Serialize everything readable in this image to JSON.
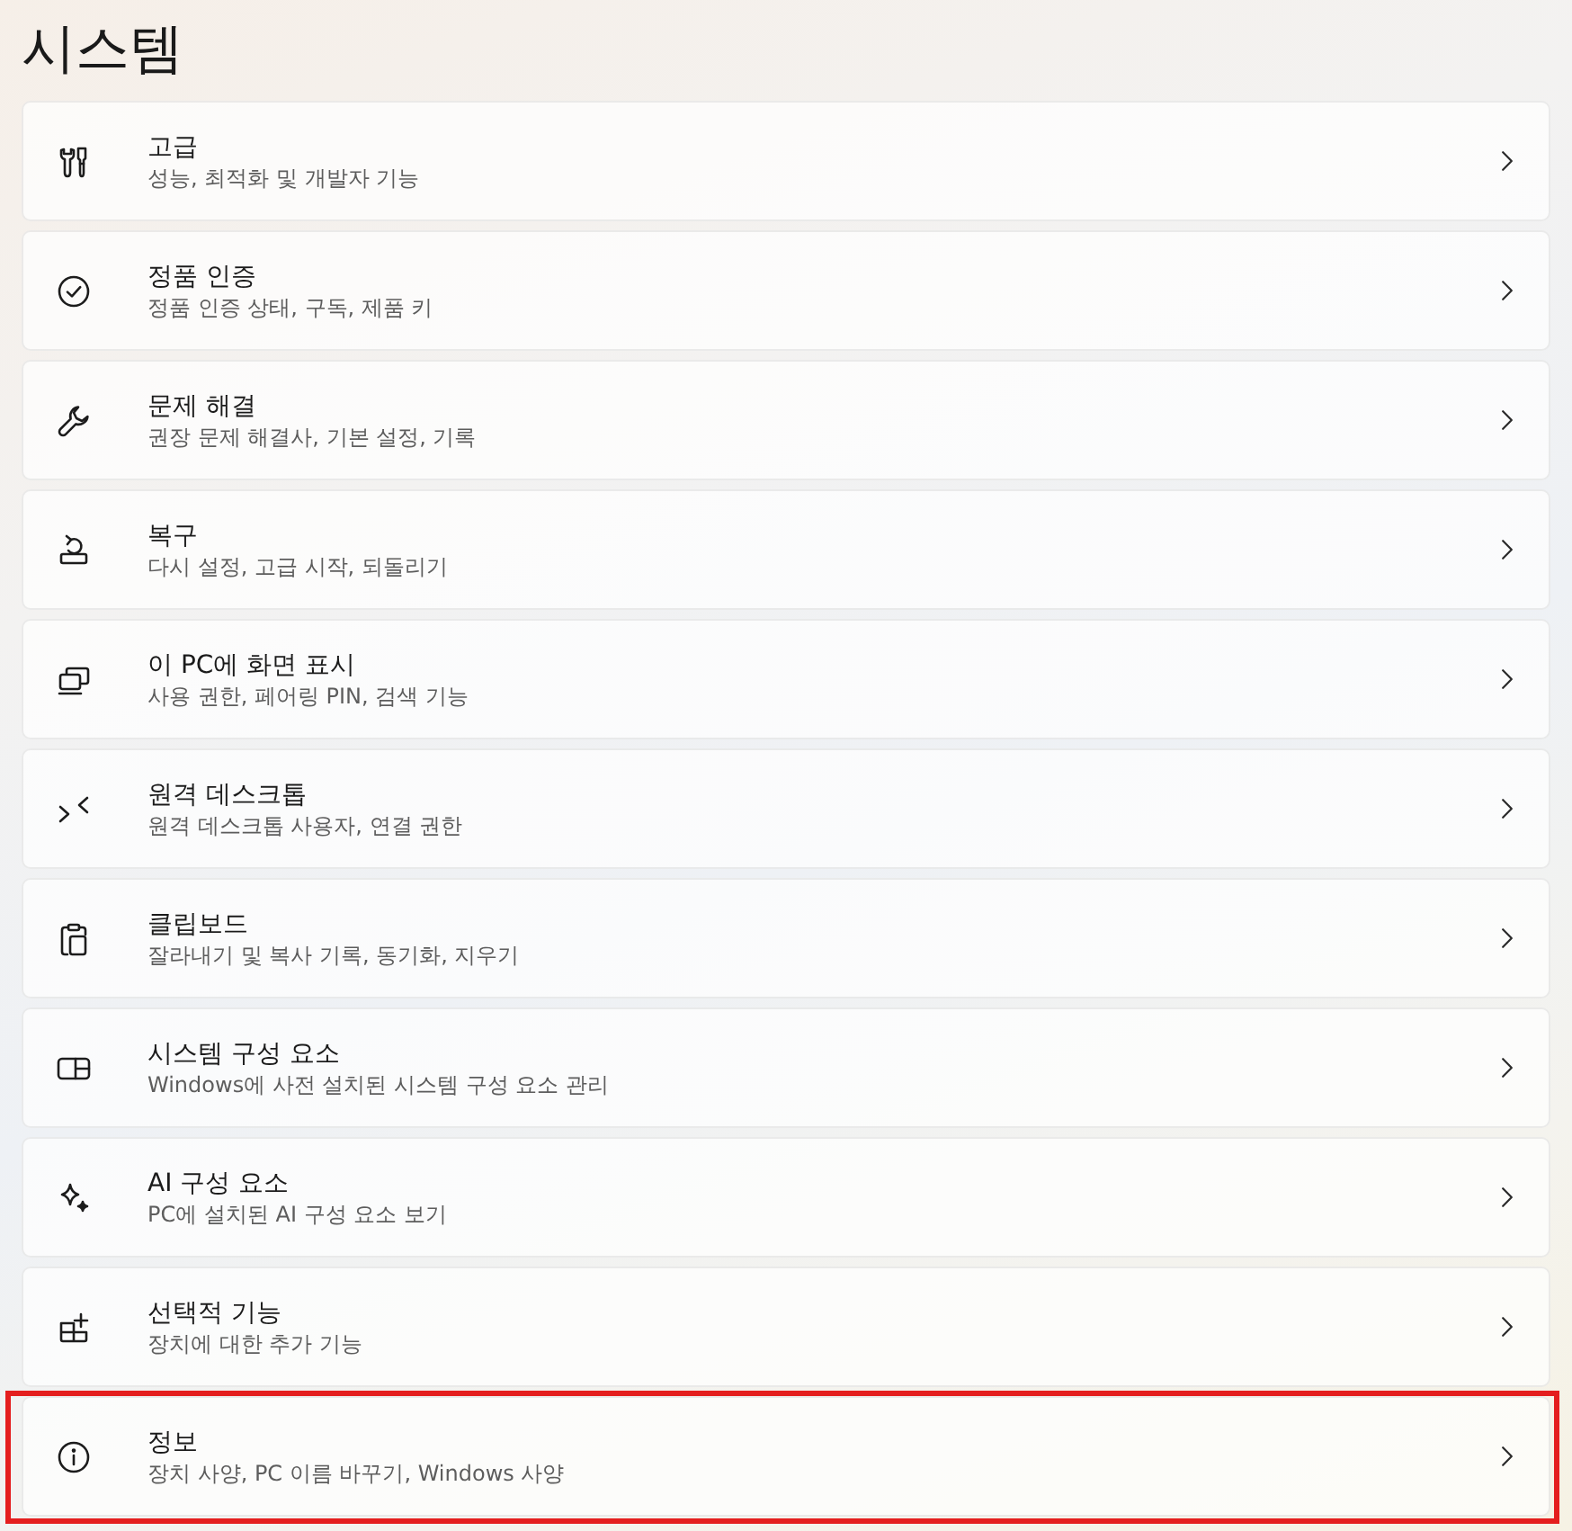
{
  "page": {
    "title": "시스템"
  },
  "items": [
    {
      "kind": "tools",
      "title": "고급",
      "description": "성능, 최적화 및 개발자 기능",
      "highlighted": false
    },
    {
      "kind": "check",
      "title": "정품 인증",
      "description": "정품 인증 상태, 구독, 제품 키",
      "highlighted": false
    },
    {
      "kind": "wrench",
      "title": "문제 해결",
      "description": "권장 문제 해결사, 기본 설정, 기록",
      "highlighted": false
    },
    {
      "kind": "recovery",
      "title": "복구",
      "description": "다시 설정, 고급 시작, 되돌리기",
      "highlighted": false
    },
    {
      "kind": "project",
      "title": "이 PC에 화면 표시",
      "description": "사용 권한, 페어링 PIN, 검색 기능",
      "highlighted": false
    },
    {
      "kind": "remote",
      "title": "원격 데스크톱",
      "description": "원격 데스크톱 사용자, 연결 권한",
      "highlighted": false
    },
    {
      "kind": "clipboard",
      "title": "클립보드",
      "description": "잘라내기 및 복사 기록, 동기화, 지우기",
      "highlighted": false
    },
    {
      "kind": "components",
      "title": "시스템 구성 요소",
      "description": "Windows에 사전 설치된 시스템 구성 요소 관리",
      "highlighted": false
    },
    {
      "kind": "sparkle",
      "title": "AI 구성 요소",
      "description": "PC에 설치된 AI 구성 요소 보기",
      "highlighted": false
    },
    {
      "kind": "addgrid",
      "title": "선택적 기능",
      "description": "장치에 대한 추가 기능",
      "highlighted": false
    },
    {
      "kind": "info",
      "title": "정보",
      "description": "장치 사양, PC 이름 바꾸기, Windows 사양",
      "highlighted": true
    }
  ]
}
